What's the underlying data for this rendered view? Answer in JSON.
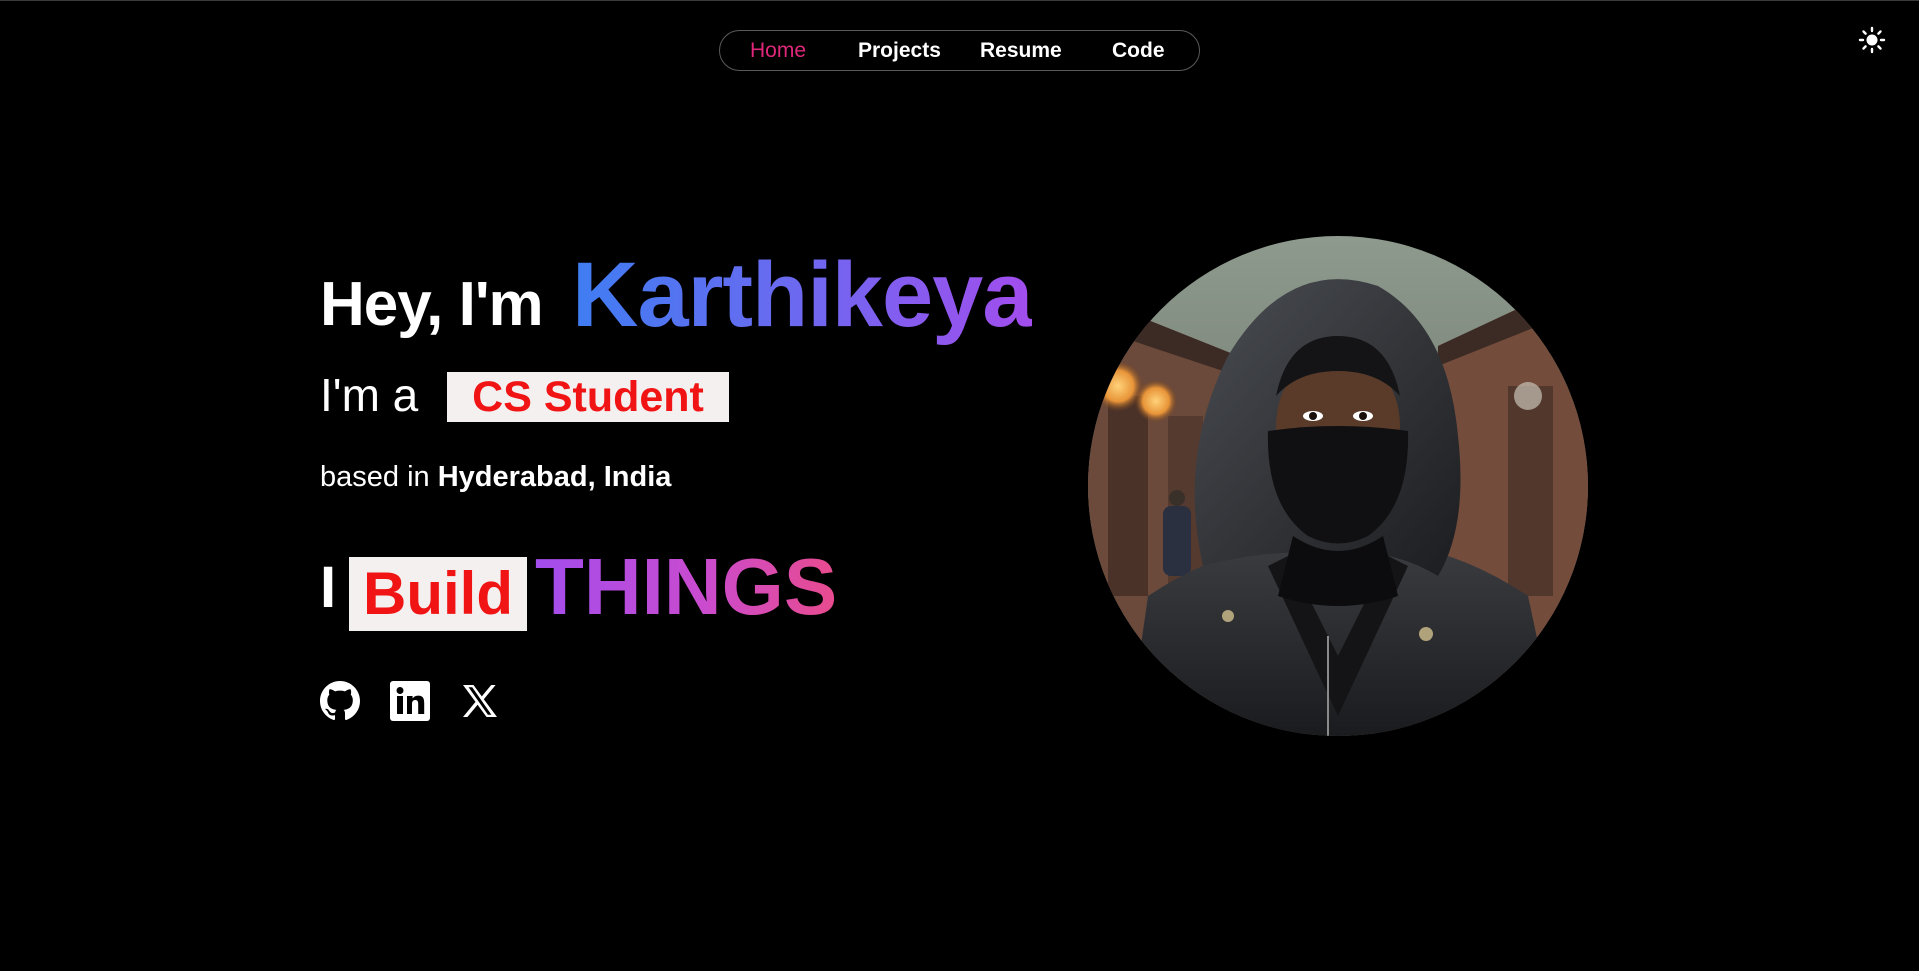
{
  "nav": {
    "items": [
      {
        "label": "Home",
        "active": true
      },
      {
        "label": "Projects",
        "active": false
      },
      {
        "label": "Resume",
        "active": false
      },
      {
        "label": "Code",
        "active": false
      }
    ],
    "active_color": "#e0287a"
  },
  "theme_toggle": {
    "icon": "sun-icon"
  },
  "hero": {
    "greeting": "Hey, I'm",
    "name": "Karthikeya",
    "role_prefix": "I'm a",
    "role": "CS Student",
    "location_prefix": "based in",
    "location": "Hyderabad, India",
    "build_prefix": "I",
    "build_word": "Build",
    "build_suffix": "THINGS"
  },
  "social": [
    {
      "icon": "github-icon"
    },
    {
      "icon": "linkedin-icon"
    },
    {
      "icon": "x-twitter-icon"
    }
  ],
  "colors": {
    "background": "#000000",
    "badge_bg": "#f4f0f0",
    "badge_text": "#f01414",
    "name_gradient": [
      "#3f7df2",
      "#a24ded"
    ],
    "things_gradient": [
      "#a24ded",
      "#e94b8d"
    ]
  }
}
